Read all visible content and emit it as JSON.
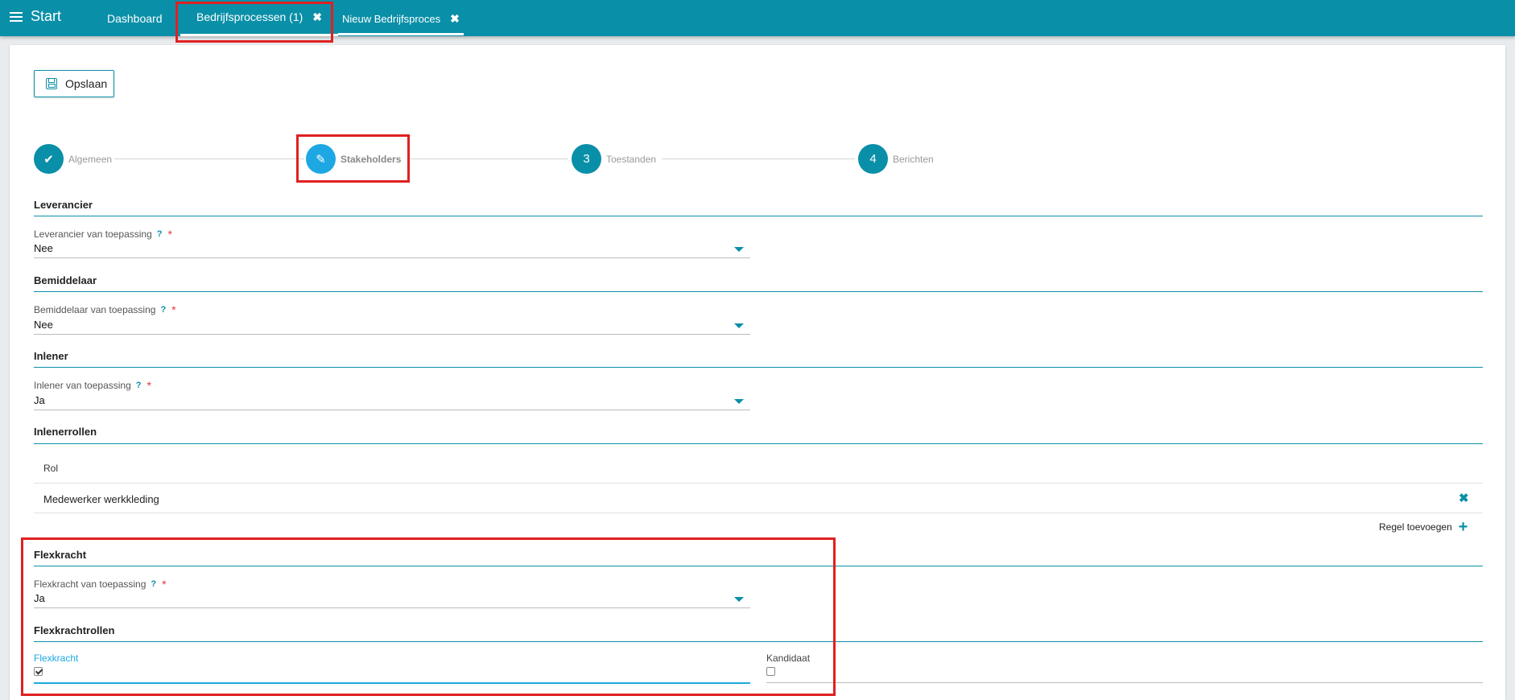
{
  "topbar": {
    "start_label": "Start",
    "tabs": [
      {
        "label": "Dashboard"
      },
      {
        "label": "Bedrijfsprocessen (1)",
        "close": "✖"
      },
      {
        "label": "Nieuw Bedrijfsproces",
        "close": "✖"
      }
    ]
  },
  "toolbar": {
    "save_label": "Opslaan"
  },
  "stepper": {
    "steps": [
      {
        "number": "✔",
        "label": "Algemeen"
      },
      {
        "number": "✎",
        "label": "Stakeholders"
      },
      {
        "number": "3",
        "label": "Toestanden"
      },
      {
        "number": "4",
        "label": "Berichten"
      }
    ]
  },
  "sections": {
    "leverancier": {
      "title": "Leverancier",
      "field_label": "Leverancier van toepassing",
      "help": "?",
      "required": "*",
      "value": "Nee"
    },
    "bemiddelaar": {
      "title": "Bemiddelaar",
      "field_label": "Bemiddelaar van toepassing",
      "help": "?",
      "required": "*",
      "value": "Nee"
    },
    "inlener": {
      "title": "Inlener",
      "field_label": "Inlener van toepassing",
      "help": "?",
      "required": "*",
      "value": "Ja"
    },
    "inlenerrollen": {
      "title": "Inlenerrollen",
      "column": "Rol",
      "rows": [
        "Medewerker werkkleding"
      ],
      "delete_icon": "✖",
      "add_label": "Regel toevoegen",
      "add_icon": "+"
    },
    "flexkracht": {
      "title": "Flexkracht",
      "field_label": "Flexkracht van toepassing",
      "help": "?",
      "required": "*",
      "value": "Ja"
    },
    "flexkrachtrollen": {
      "title": "Flexkrachtrollen",
      "options": [
        {
          "label": "Flexkracht",
          "checked": true
        },
        {
          "label": "Kandidaat",
          "checked": false
        }
      ]
    }
  },
  "colors": {
    "accent": "#0a8fa8",
    "active_step": "#1da8e3",
    "required": "#e53935",
    "annotation": "#e02020"
  }
}
